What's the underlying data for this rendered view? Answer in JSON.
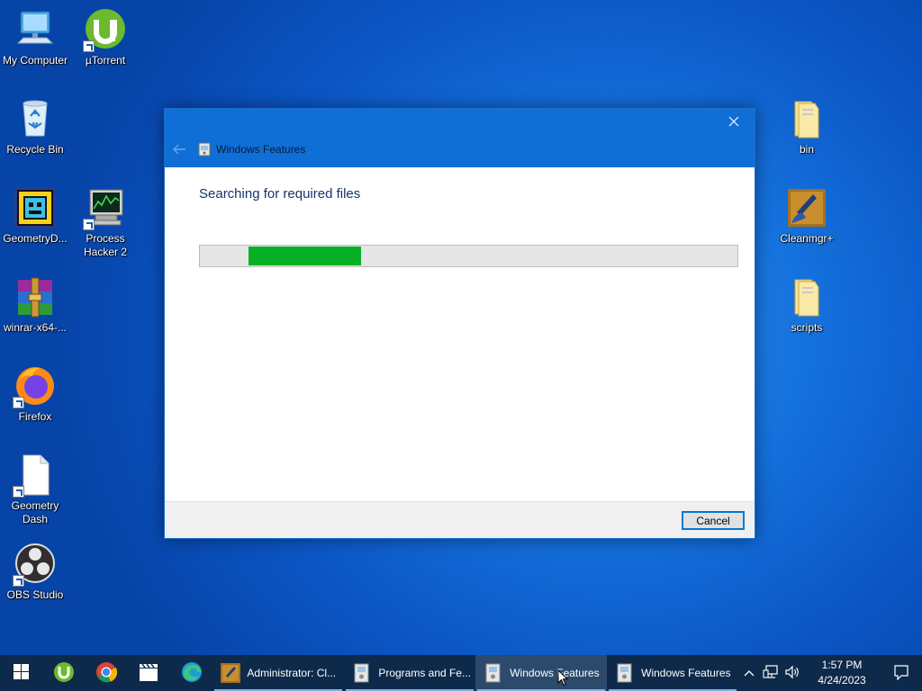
{
  "desktop": {
    "icons": {
      "my_computer": "My Computer",
      "utorrent": "µTorrent",
      "recycle_bin": "Recycle Bin",
      "geometry_dash_app": "GeometryD...",
      "process_hacker": "Process Hacker 2",
      "winrar": "winrar-x64-...",
      "firefox": "Firefox",
      "geometry_dash_file": "Geometry Dash",
      "obs_studio": "OBS Studio",
      "bin": "bin",
      "cleanmgr": "Cleanmgr+",
      "scripts": "scripts"
    }
  },
  "dialog": {
    "title": "Windows Features",
    "status": "Searching for required files",
    "progress": {
      "indeterminate": true,
      "segment_start": 0.09,
      "segment_width": 0.21,
      "color": "#06b025"
    },
    "cancel_label": "Cancel"
  },
  "taskbar": {
    "pinned": [
      "start-icon",
      "utorrent-icon",
      "chrome-icon",
      "media-player-icon",
      "edge-icon"
    ],
    "windows": [
      {
        "label": "Administrator: Cl...",
        "active": false
      },
      {
        "label": "Programs and Fe...",
        "active": false
      },
      {
        "label": "Windows Features",
        "active": true
      },
      {
        "label": "Windows Features",
        "active": false
      }
    ],
    "clock": {
      "time": "1:57 PM",
      "date": "4/24/2023"
    }
  },
  "colors": {
    "accent": "#0078d7",
    "titlebar": "#0f6fd6",
    "taskbar": "#0e2a4a",
    "progress_fill": "#06b025"
  }
}
